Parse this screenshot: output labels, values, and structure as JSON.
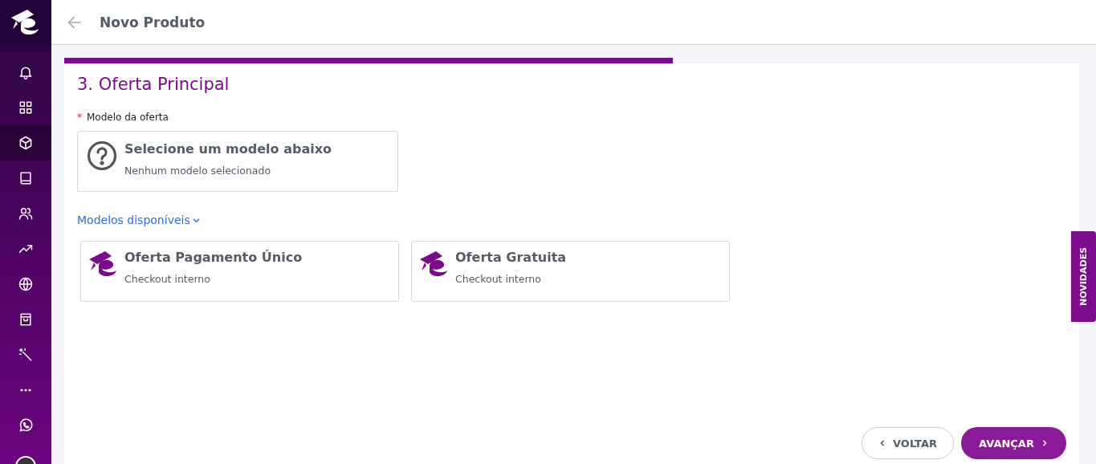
{
  "sidebar": {
    "items": [
      {
        "kind": "bell",
        "selected": false
      },
      {
        "kind": "grid",
        "selected": false
      },
      {
        "kind": "cube",
        "selected": true
      },
      {
        "kind": "book",
        "selected": false
      },
      {
        "kind": "users",
        "selected": false
      },
      {
        "kind": "trend",
        "selected": false
      },
      {
        "kind": "globe",
        "selected": false
      },
      {
        "kind": "bag",
        "selected": false
      },
      {
        "kind": "wand",
        "selected": false
      },
      {
        "kind": "dots",
        "selected": false
      },
      {
        "kind": "whatsapp",
        "selected": false
      }
    ]
  },
  "header": {
    "title": "Novo Produto"
  },
  "progress": {
    "level": 0.6
  },
  "section": {
    "title": "3. Oferta Principal",
    "field_label": "Modelo da oferta",
    "required_mark": "*",
    "selected_model": {
      "title": "Selecione um modelo abaixo",
      "subtitle": "Nenhum modelo selecionado"
    },
    "models_toggle": {
      "label": "Modelos disponíveis",
      "expanded": true
    },
    "models": [
      {
        "title": "Oferta Pagamento Único",
        "subtitle": "Checkout interno"
      },
      {
        "title": "Oferta Gratuita",
        "subtitle": "Checkout interno"
      }
    ]
  },
  "buttons": {
    "back": "VOLTAR",
    "next": "AVANÇAR"
  },
  "news_tab": "NOVIDADES"
}
